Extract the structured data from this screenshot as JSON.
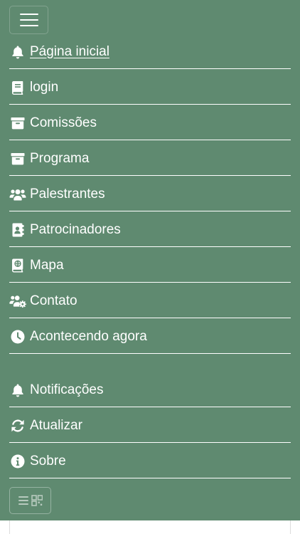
{
  "nav": {
    "items": [
      {
        "label": " Página inicial",
        "icon": "bell-icon"
      },
      {
        "label": "login",
        "icon": "book-icon"
      },
      {
        "label": "Comissões",
        "icon": "archive-icon"
      },
      {
        "label": "Programa",
        "icon": "archive-icon"
      },
      {
        "label": "Palestrantes",
        "icon": "users-icon"
      },
      {
        "label": "Patrocinadores",
        "icon": "address-book-icon"
      },
      {
        "label": "Mapa",
        "icon": "atlas-icon"
      },
      {
        "label": "Contato",
        "icon": "users-cog-icon"
      },
      {
        "label": "Acontecendo agora",
        "icon": "clock-icon"
      }
    ],
    "secondary_items": [
      {
        "label": "Notificações",
        "icon": "bell-icon"
      },
      {
        "label": "Atualizar",
        "icon": "sync-icon"
      },
      {
        "label": "Sobre",
        "icon": "info-circle-icon"
      }
    ]
  },
  "colors": {
    "panel_background": "#5f8a70",
    "text": "#ffffff"
  }
}
